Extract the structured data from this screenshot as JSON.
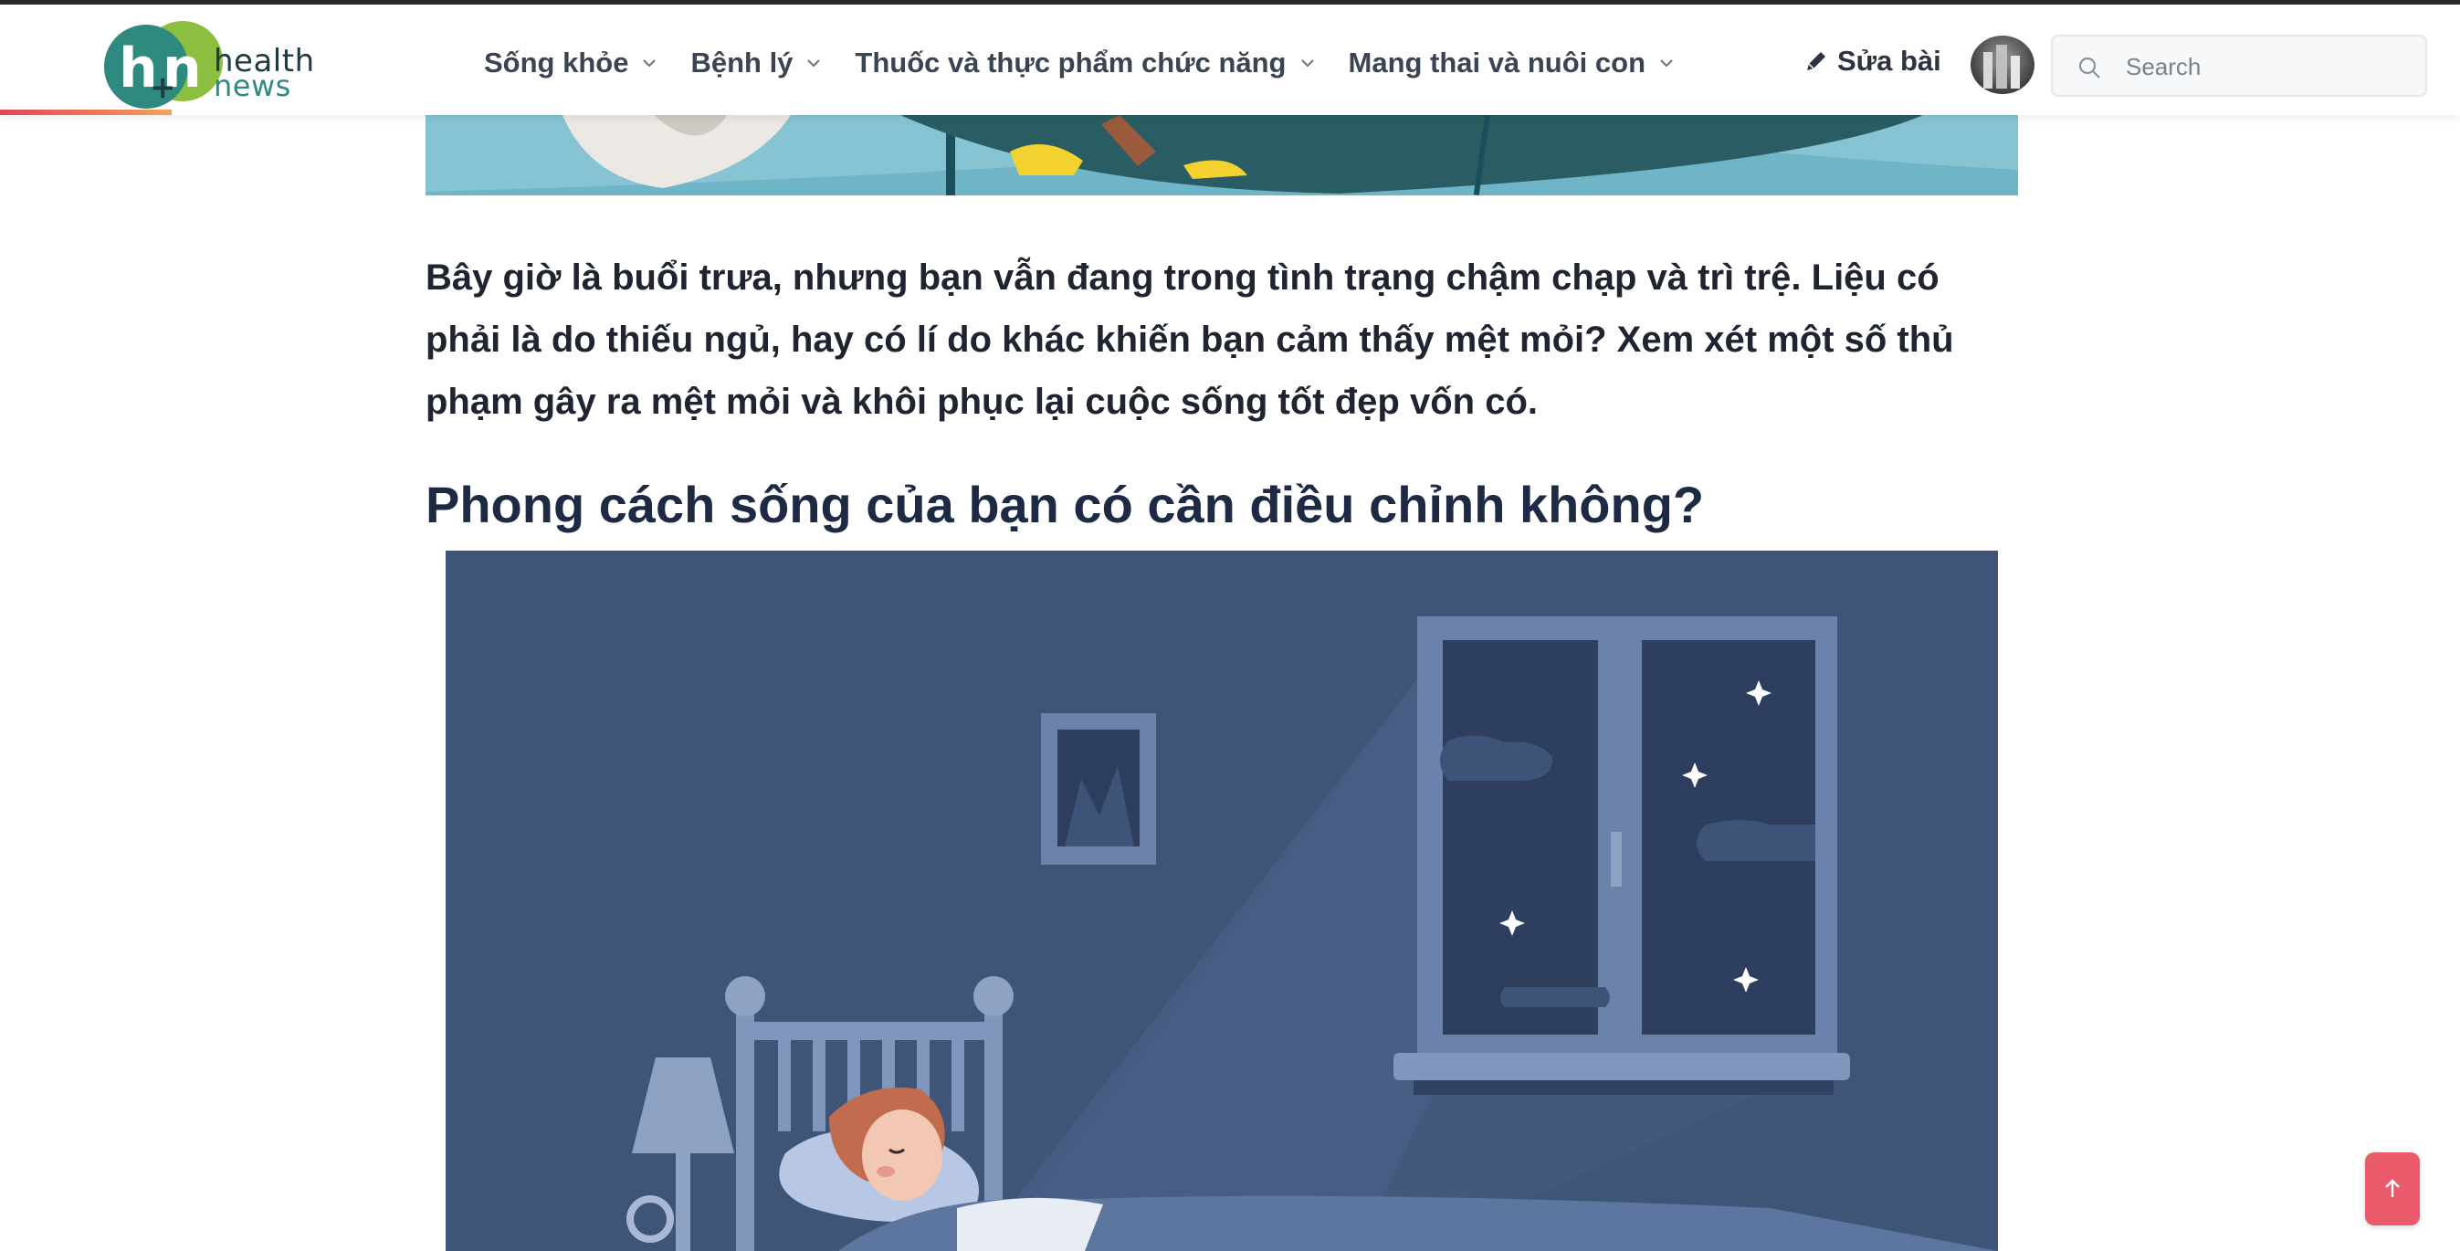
{
  "brand": {
    "line1": "health",
    "line2": "news",
    "colors": {
      "teal": "#2e8a7e",
      "green": "#8cbf3f"
    }
  },
  "nav": {
    "items": [
      {
        "label": "Sống khỏe",
        "icon": "chevron-down-icon"
      },
      {
        "label": "Bệnh lý",
        "icon": "chevron-down-icon"
      },
      {
        "label": "Thuốc và thực phẩm chức năng",
        "icon": "chevron-down-icon"
      },
      {
        "label": "Mang thai và nuôi con",
        "icon": "chevron-down-icon"
      }
    ]
  },
  "header": {
    "edit_label": "Sửa bài",
    "edit_icon": "pencil-icon"
  },
  "search": {
    "placeholder": "Search",
    "value": "",
    "icon": "search-icon"
  },
  "article": {
    "intro": "Bây giờ là buổi trưa, nhưng bạn vẫn đang trong tình trạng chậm chạp và trì trệ. Liệu có phải là do thiếu ngủ, hay có lí do khác khiến bạn cảm thấy mệt mỏi? Xem xét một số thủ phạm gây ra mệt mỏi và khôi phục lại cuộc sống tốt đẹp vốn có.",
    "section_heading": "Phong cách sống của bạn có cần điều chỉnh không?"
  },
  "scroll_top": {
    "icon": "arrow-up-icon",
    "color": "#ea5a6b"
  }
}
